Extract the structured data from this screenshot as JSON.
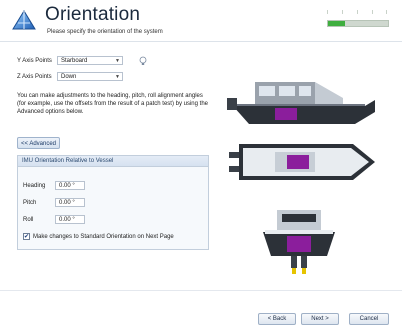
{
  "header": {
    "title": "Orientation",
    "subtitle": "Please specify the orientation of the system",
    "progress": 0.28
  },
  "axes": {
    "y_label": "Y Axis Points",
    "y_value": "Starboard",
    "z_label": "Z Axis Points",
    "z_value": "Down"
  },
  "description": "You can make adjustments to the heading, pitch, roll alignment angles (for example, use the offsets from the result of a patch test) by using the Advanced options below.",
  "advanced": {
    "button_label": "<< Advanced",
    "panel_title": "IMU Orientation Relative to Vessel",
    "fields": [
      {
        "label": "Heading",
        "value": "0.00 °"
      },
      {
        "label": "Pitch",
        "value": "0.00 °"
      },
      {
        "label": "Roll",
        "value": "0.00 °"
      }
    ],
    "checkbox_label": "Make changes to Standard Orientation on Next Page",
    "checkbox_checked": true
  },
  "footer": {
    "back": "< Back",
    "next": "Next >",
    "cancel": "Cancel"
  },
  "icons": {
    "logo": "compass-logo-icon",
    "help": "help-lightbulb-icon",
    "select_arrow": "chevron-down-icon"
  },
  "colors": {
    "accent": "#3fae3f",
    "imu_box": "#8b1e9c",
    "hull": "#2c3138"
  }
}
